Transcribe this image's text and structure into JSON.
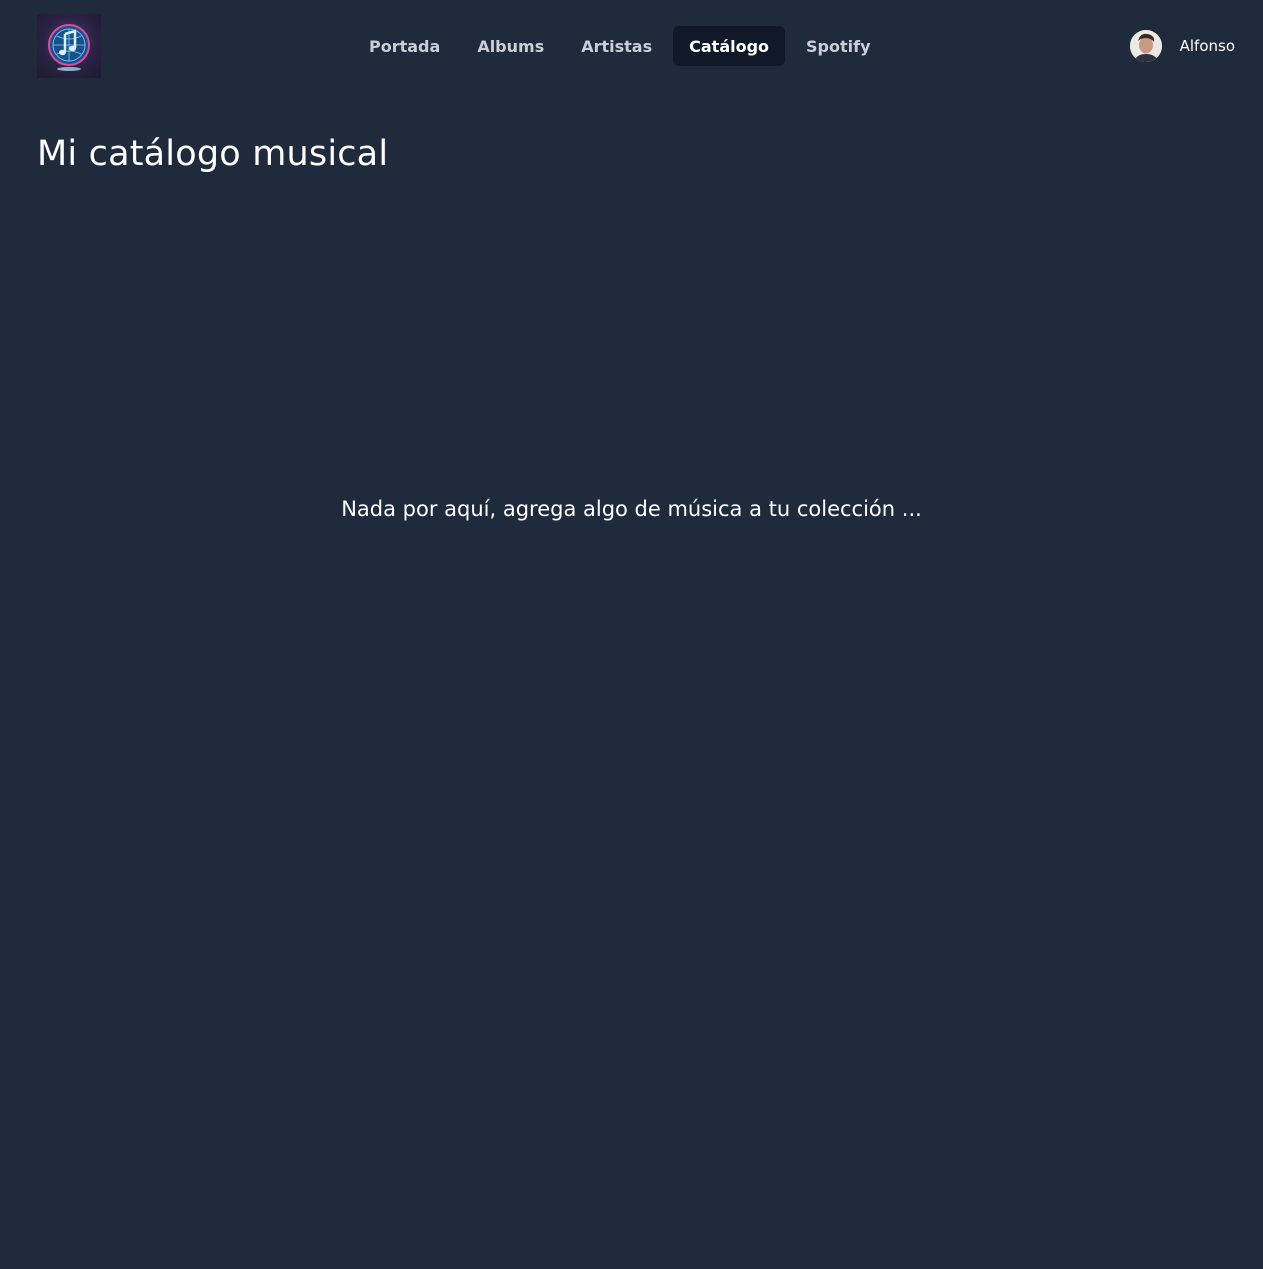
{
  "header": {
    "logo_icon": "music-note-globe-icon",
    "nav": {
      "items": [
        {
          "label": "Portada",
          "active": false
        },
        {
          "label": "Albums",
          "active": false
        },
        {
          "label": "Artistas",
          "active": false
        },
        {
          "label": "Catálogo",
          "active": true
        },
        {
          "label": "Spotify",
          "active": false
        }
      ]
    },
    "user": {
      "name": "Alfonso",
      "avatar_icon": "user-avatar"
    }
  },
  "main": {
    "title": "Mi catálogo musical",
    "empty_message": "Nada por aquí, agrega algo de música a tu colección ..."
  },
  "colors": {
    "background": "#1f2a3c",
    "nav_active_bg": "#111827",
    "nav_text": "#c9ced9",
    "text": "#ffffff"
  }
}
